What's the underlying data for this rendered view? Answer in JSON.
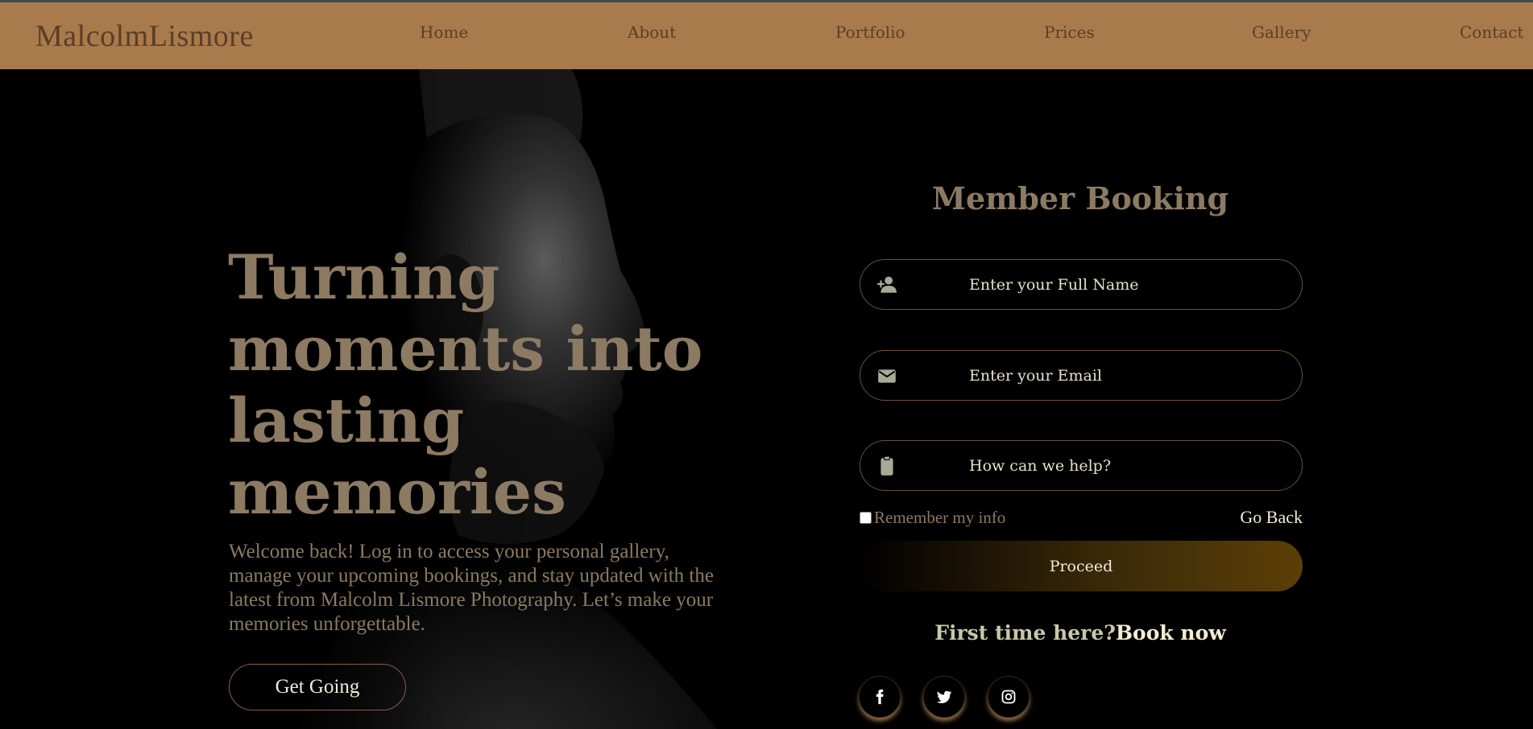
{
  "brand": {
    "logo": "MalcolmLismore"
  },
  "nav": {
    "items": [
      "Home",
      "About",
      "Portfolio",
      "Prices",
      "Gallery",
      "Contact"
    ]
  },
  "hero": {
    "headline": [
      "Turning",
      "moments into",
      "lasting",
      "memories"
    ],
    "welcome": "Welcome back! Log in to access your personal gallery, manage your upcoming bookings, and stay updated with the latest from Malcolm Lismore Photography. Let’s make your memories unforgettable.",
    "cta_label": "Get Going"
  },
  "booking": {
    "title": "Member Booking",
    "name_placeholder": "Enter your Full Name",
    "email_placeholder": "Enter your Email",
    "help_placeholder": "How can we help?",
    "remember_label": "Remember my info",
    "go_back_label": "Go Back",
    "proceed_label": "Proceed",
    "first_time_text": "First time here?",
    "book_now_label": "Book now"
  },
  "icons": {
    "name": "user-plus-icon",
    "email": "envelope-icon",
    "help": "clipboard-icon",
    "social": [
      "facebook-icon",
      "twitter-icon",
      "instagram-icon"
    ]
  },
  "colors": {
    "nav_bg": "#a97a4b",
    "nav_text": "#5a3e29",
    "accent_text": "#8c7a62",
    "field_border": "#6b5230",
    "proceed_gradient_end": "#5c3f07"
  }
}
